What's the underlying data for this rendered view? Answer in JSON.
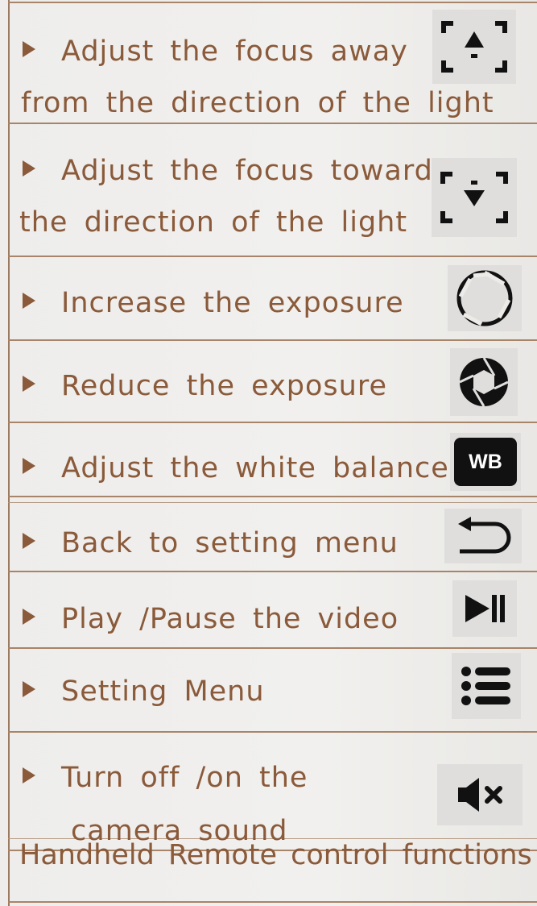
{
  "rows": [
    {
      "line1": "Adjust the focus away",
      "line2": "from the direction of the light",
      "icon": "focus-away-icon"
    },
    {
      "line1": "Adjust the focus towards",
      "line2": "the direction of the light",
      "icon": "focus-towards-icon"
    },
    {
      "line1": "Increase the exposure",
      "icon": "aperture-open-icon"
    },
    {
      "line1": "Reduce the exposure",
      "icon": "aperture-closed-icon"
    },
    {
      "line1": "Adjust the white balance",
      "icon": "white-balance-icon",
      "icon_text": "WB"
    },
    {
      "line1": "Back to setting menu",
      "icon": "back-arrow-icon"
    },
    {
      "line1": "Play /Pause the video",
      "icon": "play-pause-icon"
    },
    {
      "line1": "Setting Menu",
      "icon": "menu-list-icon"
    },
    {
      "line1": "Turn off /on the",
      "line2": "camera sound",
      "icon": "mute-icon"
    }
  ],
  "footer": "Handheld Remote control functions"
}
